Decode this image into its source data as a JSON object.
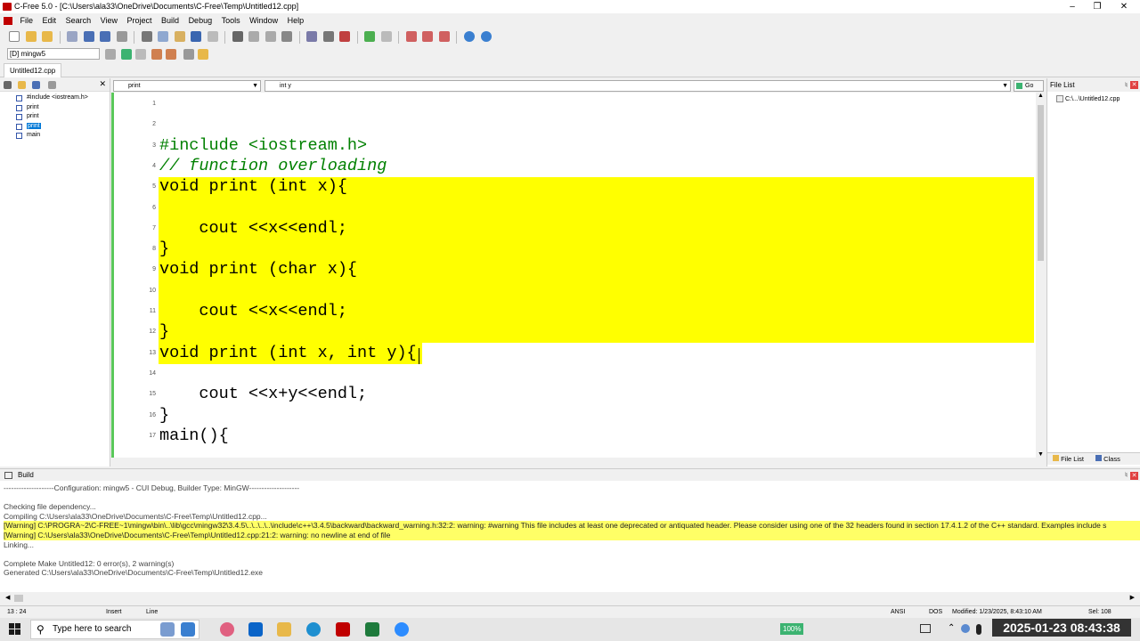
{
  "window": {
    "title": "C-Free 5.0 - [C:\\Users\\ala33\\OneDrive\\Documents\\C-Free\\Temp\\Untitled12.cpp]"
  },
  "menu": [
    "File",
    "Edit",
    "Search",
    "View",
    "Project",
    "Build",
    "Debug",
    "Tools",
    "Window",
    "Help"
  ],
  "toolbar": {
    "config": "[D] mingw5"
  },
  "tabs": {
    "active": "Untitled12.cpp"
  },
  "symbol_tree": {
    "items": [
      {
        "label": "#include <iostream.h>",
        "selected": false
      },
      {
        "label": "print",
        "selected": false
      },
      {
        "label": "print",
        "selected": false
      },
      {
        "label": "print",
        "selected": true
      },
      {
        "label": "main",
        "selected": false
      }
    ]
  },
  "editor_head": {
    "scope": "print",
    "member": "int y",
    "go": "Go"
  },
  "editor": {
    "lines": [
      {
        "n": "1",
        "text": ""
      },
      {
        "n": "2",
        "text": ""
      },
      {
        "n": "3",
        "text": "#include <iostream.h>",
        "style": "pp"
      },
      {
        "n": "4",
        "text": "// function overloading",
        "style": "cm"
      },
      {
        "n": "5",
        "text": "void print (int x){"
      },
      {
        "n": "6",
        "text": ""
      },
      {
        "n": "7",
        "text": "    cout <<x<<endl;"
      },
      {
        "n": "8",
        "text": "}"
      },
      {
        "n": "9",
        "text": "void print (char x){"
      },
      {
        "n": "10",
        "text": ""
      },
      {
        "n": "11",
        "text": "    cout <<x<<endl;"
      },
      {
        "n": "12",
        "text": "}"
      },
      {
        "n": "13",
        "text": "void print (int x, int y){"
      },
      {
        "n": "14",
        "text": ""
      },
      {
        "n": "15",
        "text": "    cout <<x+y<<endl;"
      },
      {
        "n": "16",
        "text": "}"
      },
      {
        "n": "17",
        "text": "main(){"
      }
    ]
  },
  "file_list": {
    "title": "File List",
    "items": [
      "C:\\...\\Untitled12.cpp"
    ],
    "tabs": [
      "File List",
      "Class"
    ]
  },
  "build": {
    "title": "Build",
    "lines": [
      {
        "text": "--------------------Configuration: mingw5 - CUI Debug, Builder Type: MinGW--------------------",
        "warn": false
      },
      {
        "text": "",
        "warn": false
      },
      {
        "text": "Checking file dependency...",
        "warn": false
      },
      {
        "text": "Compiling C:\\Users\\ala33\\OneDrive\\Documents\\C-Free\\Temp\\Untitled12.cpp...",
        "warn": false
      },
      {
        "text": "[Warning] C:\\PROGRA~2\\C-FREE~1\\mingw\\bin\\..\\lib\\gcc\\mingw32\\3.4.5\\..\\..\\..\\..\\include\\c++\\3.4.5\\backward\\backward_warning.h:32:2: warning: #warning This file includes at least one deprecated or antiquated header. Please consider using one of the 32 headers found in section 17.4.1.2 of the C++ standard. Examples include s",
        "warn": true
      },
      {
        "text": "[Warning] C:\\Users\\ala33\\OneDrive\\Documents\\C-Free\\Temp\\Untitled12.cpp:21:2: warning: no newline at end of file",
        "warn": true
      },
      {
        "text": "Linking...",
        "warn": false
      },
      {
        "text": "",
        "warn": false
      },
      {
        "text": "Complete Make Untitled12: 0 error(s), 2 warning(s)",
        "warn": false
      },
      {
        "text": "Generated C:\\Users\\ala33\\OneDrive\\Documents\\C-Free\\Temp\\Untitled12.exe",
        "warn": false
      }
    ]
  },
  "status": {
    "position": "13 : 24",
    "insert": "Insert",
    "line": "Line",
    "encoding": "ANSI",
    "eol": "DOS",
    "modified": "Modified: 1/23/2025, 8:43:10 AM",
    "sel": "Sel: 108"
  },
  "taskbar": {
    "search_placeholder": "Type here to search",
    "battery": "100%",
    "clock": "2025-01-23 08:43:38"
  },
  "colors": {
    "highlight": "#ffff00",
    "warning_bg": "#ffff66",
    "selection": "#0078d7"
  }
}
